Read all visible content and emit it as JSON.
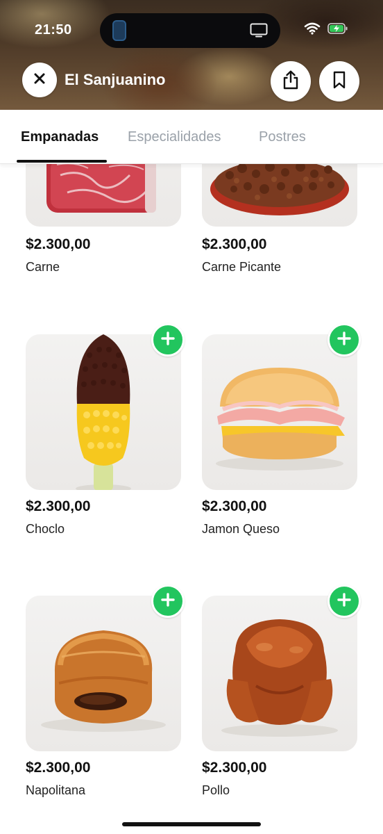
{
  "status_bar": {
    "time": "21:50"
  },
  "header": {
    "store_name": "El Sanjuanino",
    "icons": {
      "close": "close-icon",
      "share": "share-icon",
      "bookmark": "bookmark-icon"
    }
  },
  "tabs": [
    {
      "label": "Empanadas",
      "active": true
    },
    {
      "label": "Especialidades",
      "active": false
    },
    {
      "label": "Postres",
      "active": false
    }
  ],
  "products": [
    {
      "price": "$2.300,00",
      "name": "Carne",
      "image": "raw-beef-image"
    },
    {
      "price": "$2.300,00",
      "name": "Carne Picante",
      "image": "spicy-ground-meat-image"
    },
    {
      "price": "$2.300,00",
      "name": "Choclo",
      "image": "corn-cob-image"
    },
    {
      "price": "$2.300,00",
      "name": "Jamon Queso",
      "image": "ham-cheese-sandwich-image"
    },
    {
      "price": "$2.300,00",
      "name": "Napolitana",
      "image": "chocolate-croissant-image"
    },
    {
      "price": "$2.300,00",
      "name": "Pollo",
      "image": "roast-chicken-image"
    }
  ],
  "colors": {
    "accent_green": "#22c55e",
    "tab_inactive": "#9aa1a9",
    "text_primary": "#111111"
  }
}
